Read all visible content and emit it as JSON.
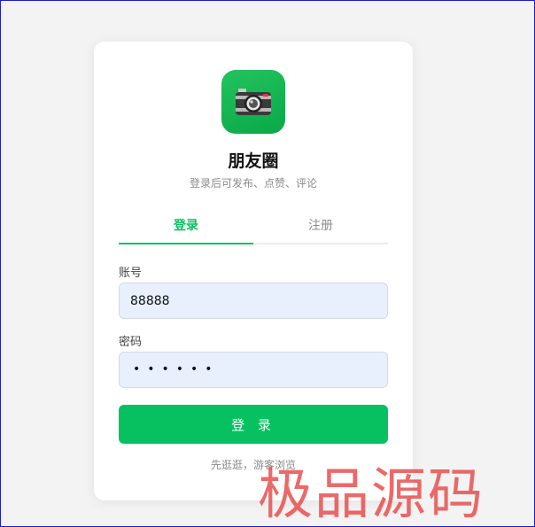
{
  "app": {
    "icon": "camera-icon",
    "title": "朋友圈",
    "subtitle": "登录后可发布、点赞、评论"
  },
  "tabs": [
    {
      "label": "登录",
      "active": true
    },
    {
      "label": "注册",
      "active": false
    }
  ],
  "form": {
    "account_label": "账号",
    "account_value": "88888",
    "password_label": "密码",
    "password_value": "••••••",
    "submit_label": "登 录"
  },
  "guest_link": "先逛逛，游客浏览",
  "watermark": "极品源码",
  "colors": {
    "accent": "#07c160",
    "input_bg": "#e8f0fe",
    "watermark": "#e84848"
  }
}
